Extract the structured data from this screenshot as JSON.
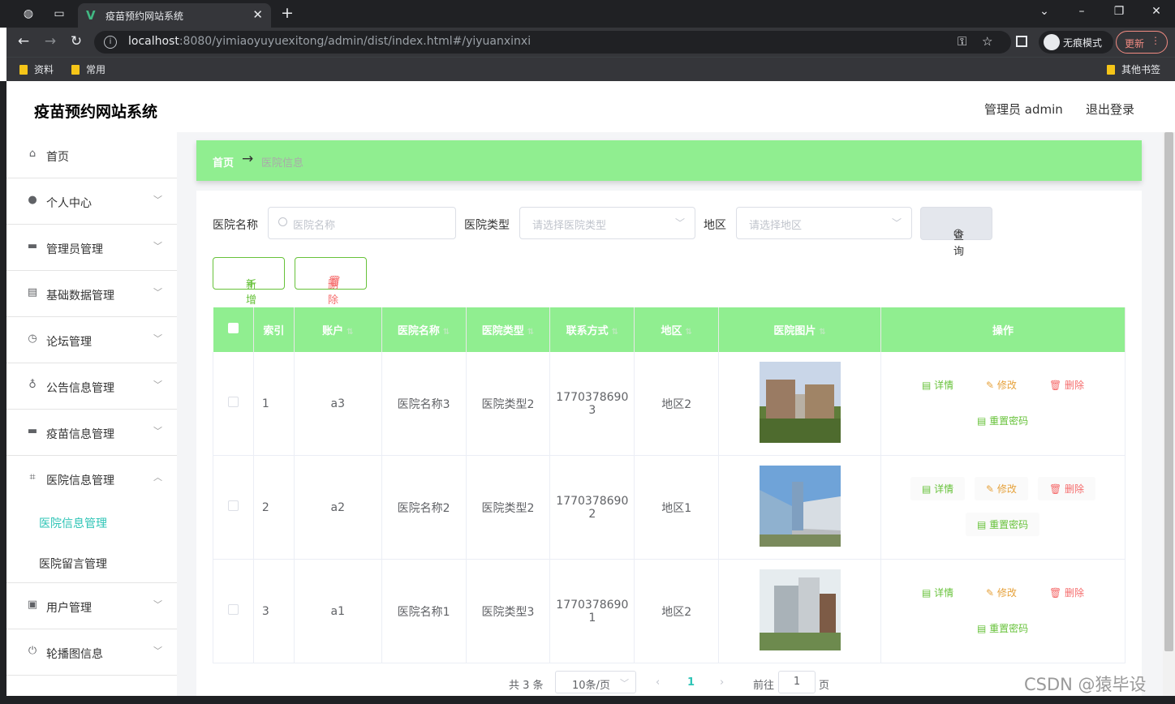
{
  "browser": {
    "tab_title": "疫苗预约网站系统",
    "url_host": "localhost",
    "url_rest": ":8080/yimiaoyuyuexitong/admin/dist/index.html#/yiyuanxinxi",
    "incognito_label": "无痕模式",
    "update_label": "更新",
    "bookmarks": [
      "资料",
      "常用"
    ],
    "other_bookmarks": "其他书签"
  },
  "header": {
    "title": "疫苗预约网站系统",
    "user": "管理员 admin",
    "logout": "退出登录"
  },
  "sidebar": {
    "items": [
      {
        "label": "首页",
        "icon": "home-icon"
      },
      {
        "label": "个人中心",
        "icon": "user-icon"
      },
      {
        "label": "管理员管理",
        "icon": "briefcase-icon"
      },
      {
        "label": "基础数据管理",
        "icon": "clipboard-icon"
      },
      {
        "label": "论坛管理",
        "icon": "clock-icon"
      },
      {
        "label": "公告信息管理",
        "icon": "microphone-icon"
      },
      {
        "label": "疫苗信息管理",
        "icon": "monitor-icon"
      },
      {
        "label": "医院信息管理",
        "icon": "crop-icon"
      },
      {
        "label": "用户管理",
        "icon": "checklist-icon"
      },
      {
        "label": "轮播图信息",
        "icon": "power-icon"
      }
    ],
    "sub_items": [
      "医院信息管理",
      "医院留言管理"
    ],
    "active_color": "#2ec4b6"
  },
  "breadcrumb": {
    "home": "首页",
    "current": "医院信息"
  },
  "filters": {
    "name_label": "医院名称",
    "name_placeholder": "医院名称",
    "type_label": "医院类型",
    "type_placeholder": "请选择医院类型",
    "region_label": "地区",
    "region_placeholder": "请选择地区",
    "query_label": "查询"
  },
  "actions": {
    "add": "新增",
    "delete": "删除"
  },
  "table": {
    "headers": [
      "索引",
      "账户",
      "医院名称",
      "医院类型",
      "联系方式",
      "地区",
      "医院图片",
      "操作"
    ],
    "rows": [
      {
        "index": "1",
        "account": "a3",
        "name": "医院名称3",
        "type": "医院类型2",
        "phone1": "1770378690",
        "phone2": "3",
        "region": "地区2"
      },
      {
        "index": "2",
        "account": "a2",
        "name": "医院名称2",
        "type": "医院类型2",
        "phone1": "1770378690",
        "phone2": "2",
        "region": "地区1"
      },
      {
        "index": "3",
        "account": "a1",
        "name": "医院名称1",
        "type": "医院类型3",
        "phone1": "1770378690",
        "phone2": "1",
        "region": "地区2"
      }
    ],
    "ops": {
      "detail": "详情",
      "edit": "修改",
      "delete": "删除",
      "reset": "重置密码"
    }
  },
  "pagination": {
    "total": "共 3 条",
    "page_size": "10条/页",
    "current": "1",
    "goto": "前往",
    "goto_value": "1",
    "page_unit": "页"
  },
  "watermark": "CSDN @猿毕设",
  "colors": {
    "accent_green": "#90ee90",
    "detail": "#67c23a",
    "edit": "#e6a23c",
    "delete": "#f56c6c"
  }
}
